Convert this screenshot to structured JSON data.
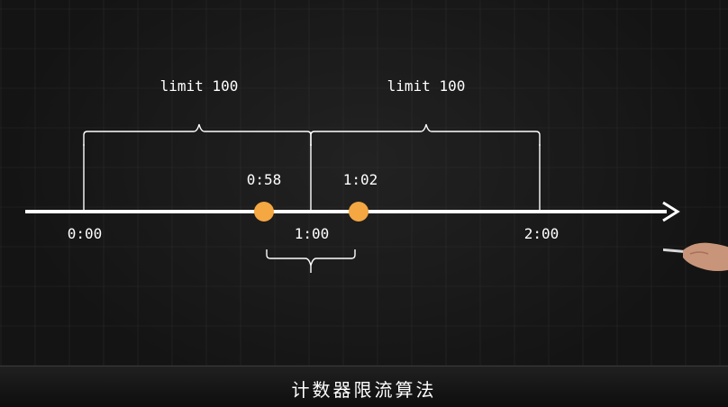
{
  "diagram": {
    "window_labels": [
      "limit 100",
      "limit 100"
    ],
    "time_labels": [
      "0:00",
      "1:00",
      "2:00"
    ],
    "request_labels": [
      "0:58",
      "1:02"
    ],
    "request_point_color": "#f5a742",
    "line_color": "#ffffff"
  },
  "subtitle": "计数器限流算法"
}
